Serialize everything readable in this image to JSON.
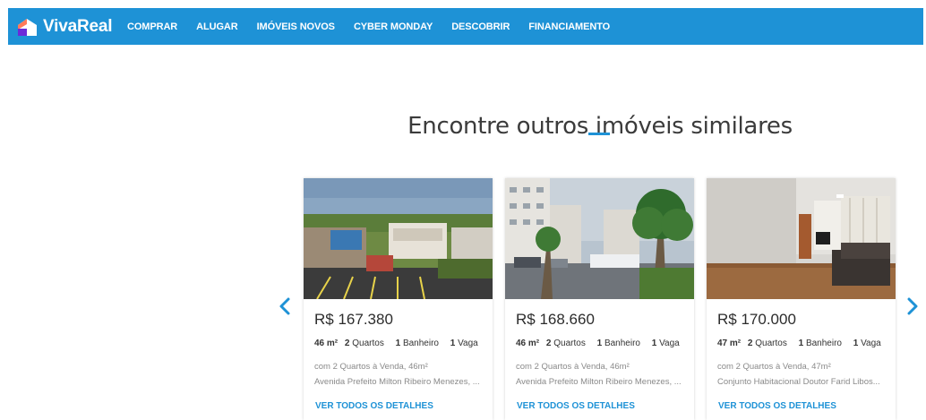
{
  "brand": {
    "name": "VivaReal",
    "color": "#1e92d6"
  },
  "nav": {
    "items": [
      {
        "label": "COMPRAR"
      },
      {
        "label": "ALUGAR"
      },
      {
        "label": "IMÓVEIS NOVOS"
      },
      {
        "label": "CYBER MONDAY"
      },
      {
        "label": "DESCOBRIR"
      },
      {
        "label": "FINANCIAMENTO"
      }
    ]
  },
  "section": {
    "title": "Encontre outros imóveis similares"
  },
  "carousel": {
    "prev_icon": "chevron-left-icon",
    "next_icon": "chevron-right-icon",
    "cards": [
      {
        "price": "R$ 167.380",
        "area": "46 m²",
        "rooms_num": "2",
        "rooms_label": "Quartos",
        "baths_num": "1",
        "baths_label": "Banheiro",
        "parking_num": "1",
        "parking_label": "Vaga",
        "desc": "com 2 Quartos à Venda, 46m²",
        "address": "Avenida Prefeito Milton Ribeiro Menezes, ...",
        "cta": "VER TODOS OS DETALHES"
      },
      {
        "price": "R$ 168.660",
        "area": "46 m²",
        "rooms_num": "2",
        "rooms_label": "Quartos",
        "baths_num": "1",
        "baths_label": "Banheiro",
        "parking_num": "1",
        "parking_label": "Vaga",
        "desc": "com 2 Quartos à Venda, 46m²",
        "address": "Avenida Prefeito Milton Ribeiro Menezes, ...",
        "cta": "VER TODOS OS DETALHES"
      },
      {
        "price": "R$ 170.000",
        "area": "47 m²",
        "rooms_num": "2",
        "rooms_label": "Quartos",
        "baths_num": "1",
        "baths_label": "Banheiro",
        "parking_num": "1",
        "parking_label": "Vaga",
        "desc": "com 2 Quartos à Venda, 47m²",
        "address": "Conjunto Habitacional Doutor Farid Libos...",
        "cta": "VER TODOS OS DETALHES"
      }
    ]
  }
}
